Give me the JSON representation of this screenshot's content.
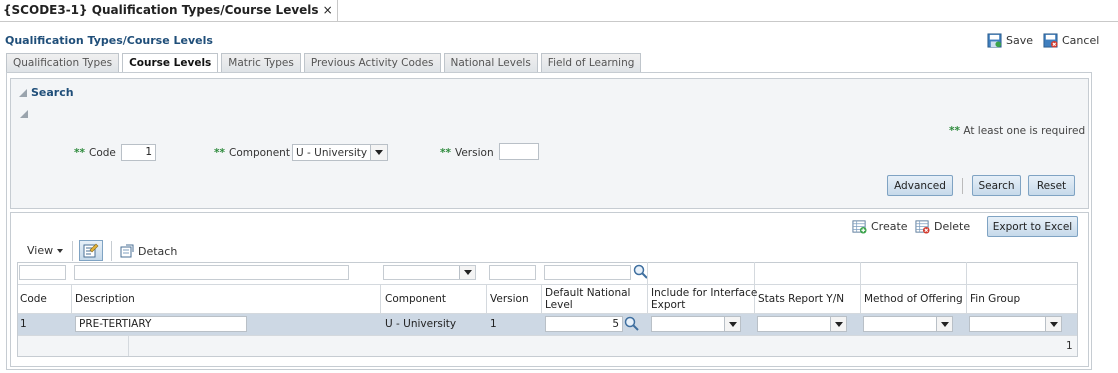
{
  "document_tab": {
    "title": "{SCODE3-1} Qualification Types/Course Levels",
    "close": "×"
  },
  "page": {
    "title": "Qualification Types/Course Levels"
  },
  "toolbar": {
    "save": "Save",
    "cancel": "Cancel"
  },
  "tabs": [
    {
      "label": "Qualification Types",
      "active": false
    },
    {
      "label": "Course Levels",
      "active": true
    },
    {
      "label": "Matric Types",
      "active": false
    },
    {
      "label": "Previous Activity Codes",
      "active": false
    },
    {
      "label": "National Levels",
      "active": false
    },
    {
      "label": "Field of Learning",
      "active": false
    }
  ],
  "search": {
    "title": "Search",
    "required_marker": "**",
    "required_note": "At least one is required",
    "fields": {
      "code": {
        "label": "Code",
        "value": "1"
      },
      "component": {
        "label": "Component",
        "value": "U - University"
      },
      "version": {
        "label": "Version",
        "value": ""
      }
    },
    "buttons": {
      "advanced": "Advanced",
      "search": "Search",
      "reset": "Reset"
    }
  },
  "results": {
    "actions": {
      "create": "Create",
      "delete": "Delete",
      "export": "Export to Excel"
    },
    "view_menu": "View",
    "detach": "Detach",
    "columns": {
      "code": "Code",
      "description": "Description",
      "component": "Component",
      "version": "Version",
      "default_national_level_1": "Default National",
      "default_national_level_2": "Level",
      "include_interface_1": "Include for Interface",
      "include_interface_2": "Export",
      "stats_report": "Stats Report Y/N",
      "method_of_offering": "Method of Offering",
      "fin_group": "Fin Group"
    },
    "rows": [
      {
        "code": "1",
        "description": "PRE-TERTIARY",
        "component": "U - University",
        "version": "1",
        "default_national_level": "5",
        "include_interface": "",
        "stats_report": "",
        "method_of_offering": "",
        "fin_group": ""
      }
    ],
    "row_count": "1"
  },
  "colors": {
    "title_blue": "#1f4e79",
    "required_green": "#2e8b3d",
    "selected_row": "#cdd8e4"
  }
}
